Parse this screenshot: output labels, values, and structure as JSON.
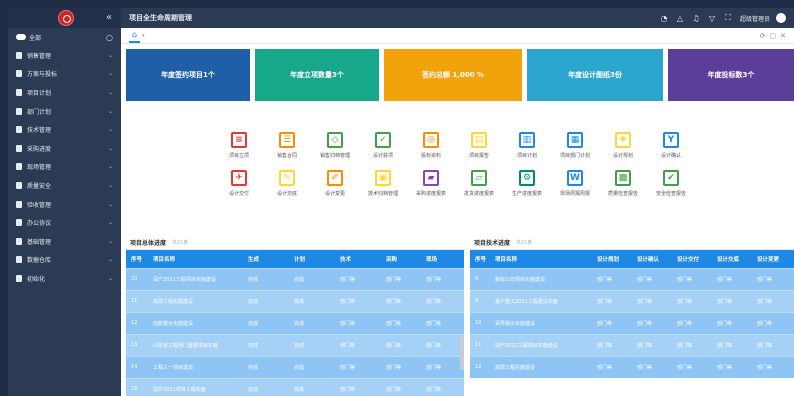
{
  "app": {
    "title": "项目全生命周期管理",
    "user": "超级管理员"
  },
  "sidebar": {
    "search_label": "全部",
    "items": [
      {
        "label": "销售管理"
      },
      {
        "label": "方案与投标"
      },
      {
        "label": "项目计划"
      },
      {
        "label": "部门计划"
      },
      {
        "label": "技术管理"
      },
      {
        "label": "采购进度"
      },
      {
        "label": "现场管理"
      },
      {
        "label": "质量安全"
      },
      {
        "label": "验收管理"
      },
      {
        "label": "办公协议"
      },
      {
        "label": "基础管理"
      },
      {
        "label": "数据仓库"
      },
      {
        "label": "初始化"
      }
    ]
  },
  "cards": [
    {
      "label": "年度签约项目1个",
      "color": "#1f5fa8"
    },
    {
      "label": "年度立项数量3个",
      "color": "#17a78a"
    },
    {
      "label": "签约总额 1,000 %",
      "color": "#f2a20a"
    },
    {
      "label": "年度设计图纸3份",
      "color": "#2ba7cf"
    },
    {
      "label": "年度投标数3个",
      "color": "#5a3e99"
    }
  ],
  "quick_links": {
    "row1": [
      {
        "label": "项目立项",
        "icon": "doc-icon",
        "glyph": "≡",
        "color": "#e53935"
      },
      {
        "label": "销售合同",
        "icon": "contract-icon",
        "glyph": "☰",
        "color": "#fb8c00"
      },
      {
        "label": "销售归档管理",
        "icon": "box-icon",
        "glyph": "◇",
        "color": "#43a047"
      },
      {
        "label": "设计获项",
        "icon": "list-check-icon",
        "glyph": "✓",
        "color": "#43a047"
      },
      {
        "label": "投标资料",
        "icon": "target-icon",
        "glyph": "◎",
        "color": "#fb8c00"
      },
      {
        "label": "项目报告",
        "icon": "clipboard-icon",
        "glyph": "▤",
        "color": "#fdd835"
      },
      {
        "label": "项目计划",
        "icon": "bar-chart-icon",
        "glyph": "▥",
        "color": "#1e88e5"
      },
      {
        "label": "项目部门计划",
        "icon": "calendar-icon",
        "glyph": "▦",
        "color": "#1e88e5"
      },
      {
        "label": "设计规划",
        "icon": "bulb-icon",
        "glyph": "✺",
        "color": "#fdd835"
      },
      {
        "label": "设计确认",
        "icon": "yen-icon",
        "glyph": "Y",
        "color": "#1e88e5"
      }
    ],
    "row2": [
      {
        "label": "设计交付",
        "icon": "plane-icon",
        "glyph": "✈",
        "color": "#e53935"
      },
      {
        "label": "设计交底",
        "icon": "edit-icon",
        "glyph": "✎",
        "color": "#fdd835"
      },
      {
        "label": "设计变更",
        "icon": "pencil-icon",
        "glyph": "✐",
        "color": "#fb8c00"
      },
      {
        "label": "技术归档管理",
        "icon": "folder-icon",
        "glyph": "▣",
        "color": "#fdd835"
      },
      {
        "label": "采购进度报表",
        "icon": "truck-icon",
        "glyph": "▰",
        "color": "#8e44ad"
      },
      {
        "label": "发货进度报表",
        "icon": "delivery-icon",
        "glyph": "▱",
        "color": "#43a047"
      },
      {
        "label": "生产进度报表",
        "icon": "gear-icon",
        "glyph": "⚙",
        "color": "#00897b"
      },
      {
        "label": "现场周报周报",
        "icon": "word-icon",
        "glyph": "W",
        "color": "#1e88e5"
      },
      {
        "label": "质量检查报告",
        "icon": "image-icon",
        "glyph": "▩",
        "color": "#43a047"
      },
      {
        "label": "安全检查报告",
        "icon": "check-edit-icon",
        "glyph": "✔",
        "color": "#43a047"
      }
    ]
  },
  "panel_left": {
    "title": "项目总体进度",
    "more": "共21条",
    "columns": [
      "序号",
      "项目名称",
      "生成",
      "计划",
      "技术",
      "采购",
      "现场"
    ],
    "rows": [
      [
        "10",
        "深产2021工程项目实施建设",
        "完成",
        "完成",
        "部门等",
        "部门等",
        "部门等"
      ],
      [
        "11",
        "高层工程实施建设",
        "完成",
        "完成",
        "部门等",
        "部门等",
        "部门等"
      ],
      [
        "12",
        "创新整合实施建设",
        "完成",
        "完成",
        "部门等",
        "部门等",
        "部门等"
      ],
      [
        "13",
        "山东省工程部门重要项目实施",
        "完成",
        "完成",
        "部门等",
        "部门等",
        "部门等"
      ],
      [
        "14",
        "工程三一项目建设",
        "完成",
        "完成",
        "部门等",
        "部门等",
        "部门等"
      ],
      [
        "15",
        "提升2021项目工程实施",
        "完成",
        "完成",
        "部门等",
        "部门等",
        "部门等"
      ]
    ]
  },
  "panel_right": {
    "title": "项目技术进度",
    "more": "共21条",
    "columns": [
      "序号",
      "项目名称",
      "设计规划",
      "设计确认",
      "设计交付",
      "设计交底",
      "设计变更"
    ],
    "rows": [
      [
        "8",
        "我标公司项目实施建设",
        "部门等",
        "部门等",
        "部门等",
        "部门等",
        "部门等"
      ],
      [
        "9",
        "番户重工2021工程建设实施",
        "部门等",
        "部门等",
        "部门等",
        "部门等",
        "部门等"
      ],
      [
        "10",
        "百界报价实施建设",
        "部门等",
        "部门等",
        "部门等",
        "部门等",
        "部门等"
      ],
      [
        "11",
        "深产2021工程项目实施建设",
        "部门等",
        "部门等",
        "部门等",
        "部门等",
        "部门等"
      ],
      [
        "12",
        "高层工程实施建设",
        "部门等",
        "部门等",
        "部门等",
        "部门等",
        "部门等"
      ]
    ]
  },
  "topbar_icons": [
    "bell-icon",
    "warning-icon",
    "notification-icon",
    "shirt-icon",
    "fullscreen-icon"
  ]
}
